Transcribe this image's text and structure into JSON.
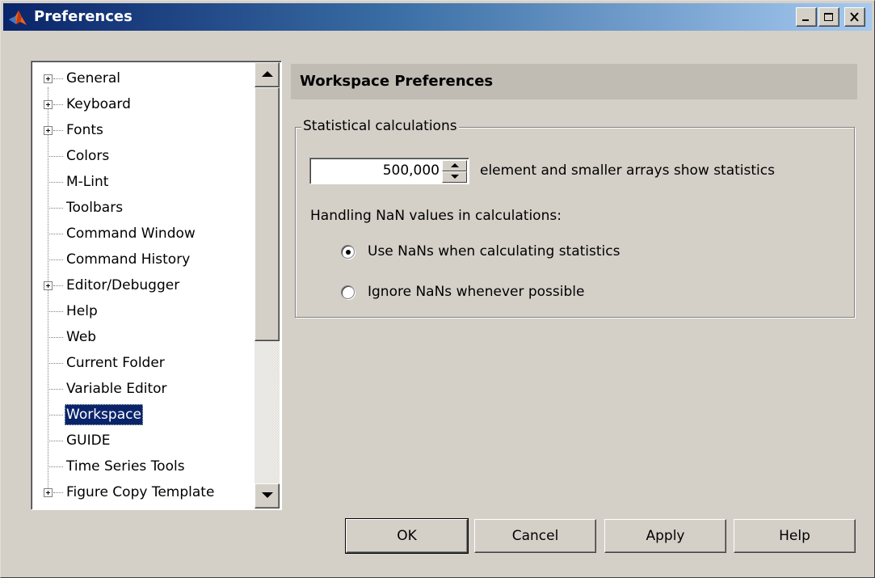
{
  "window": {
    "title": "Preferences"
  },
  "tree": {
    "items": [
      {
        "label": "General",
        "expandable": true
      },
      {
        "label": "Keyboard",
        "expandable": true
      },
      {
        "label": "Fonts",
        "expandable": true
      },
      {
        "label": "Colors",
        "expandable": false
      },
      {
        "label": "M-Lint",
        "expandable": false
      },
      {
        "label": "Toolbars",
        "expandable": false
      },
      {
        "label": "Command Window",
        "expandable": false
      },
      {
        "label": "Command History",
        "expandable": false
      },
      {
        "label": "Editor/Debugger",
        "expandable": true
      },
      {
        "label": "Help",
        "expandable": false
      },
      {
        "label": "Web",
        "expandable": false
      },
      {
        "label": "Current Folder",
        "expandable": false
      },
      {
        "label": "Variable Editor",
        "expandable": false
      },
      {
        "label": "Workspace",
        "expandable": false,
        "selected": true
      },
      {
        "label": "GUIDE",
        "expandable": false
      },
      {
        "label": "Time Series Tools",
        "expandable": false
      },
      {
        "label": "Figure Copy Template",
        "expandable": true
      }
    ]
  },
  "panel": {
    "header": "Workspace Preferences",
    "group_title": "Statistical calculations",
    "array_limit_value": "500,000",
    "array_limit_text": "element and smaller arrays show statistics",
    "nan_label": "Handling NaN values in calculations:",
    "radio_use_nans": "Use NaNs when calculating statistics",
    "radio_ignore_nans": "Ignore NaNs whenever possible",
    "selected_radio": "use_nans"
  },
  "buttons": {
    "ok": "OK",
    "cancel": "Cancel",
    "apply": "Apply",
    "help": "Help"
  }
}
